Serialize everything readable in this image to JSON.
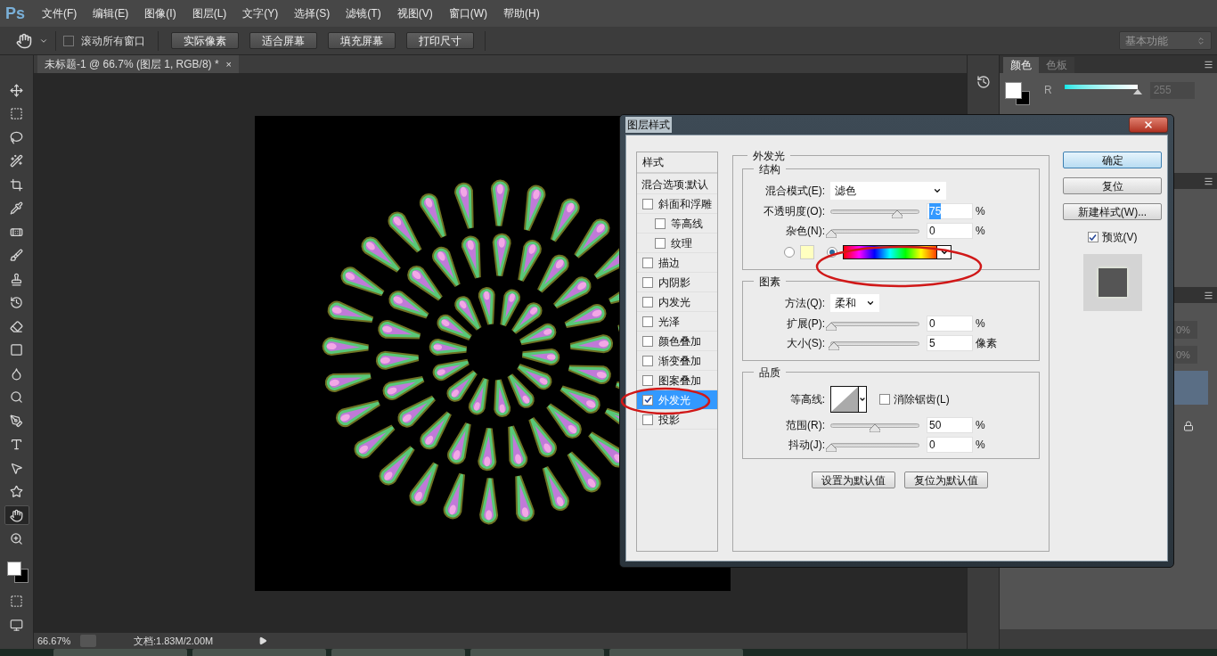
{
  "app": {
    "logo": "Ps"
  },
  "menu": [
    "文件(F)",
    "编辑(E)",
    "图像(I)",
    "图层(L)",
    "文字(Y)",
    "选择(S)",
    "滤镜(T)",
    "视图(V)",
    "窗口(W)",
    "帮助(H)"
  ],
  "options_bar": {
    "scroll_all": {
      "label": "滚动所有窗口",
      "checked": false
    },
    "buttons": [
      "实际像素",
      "适合屏幕",
      "填充屏幕",
      "打印尺寸"
    ],
    "workspace": "基本功能"
  },
  "document_tab": {
    "title": "未标题-1 @ 66.7% (图层 1, RGB/8) *",
    "close": "×"
  },
  "tools": [
    {
      "kind": "move",
      "selected": false
    },
    {
      "kind": "marquee",
      "selected": false
    },
    {
      "kind": "lasso",
      "selected": false
    },
    {
      "kind": "wand",
      "selected": false
    },
    {
      "kind": "crop",
      "selected": false
    },
    {
      "kind": "eyedropper",
      "selected": false
    },
    {
      "kind": "healing",
      "selected": false
    },
    {
      "kind": "brush",
      "selected": false
    },
    {
      "kind": "stamp",
      "selected": false
    },
    {
      "kind": "history",
      "selected": false
    },
    {
      "kind": "eraser",
      "selected": false
    },
    {
      "kind": "gradient",
      "selected": false
    },
    {
      "kind": "blur",
      "selected": false
    },
    {
      "kind": "dodge",
      "selected": false
    },
    {
      "kind": "pen",
      "selected": false
    },
    {
      "kind": "type",
      "selected": false
    },
    {
      "kind": "select",
      "selected": false
    },
    {
      "kind": "shape",
      "selected": false
    },
    {
      "kind": "hand",
      "selected": true
    },
    {
      "kind": "zoom",
      "selected": false
    }
  ],
  "color_panel": {
    "tabs": [
      {
        "label": "颜色",
        "selected": true
      },
      {
        "label": "色板",
        "selected": false
      }
    ],
    "channel": "R",
    "level": 1,
    "value": "255"
  },
  "layers_panel": {
    "fields": [
      "0%",
      "0%"
    ]
  },
  "status_bar": {
    "zoom": "66.67%",
    "document": "文档:1.83M/2.00M"
  },
  "dialog": {
    "title": "图层样式",
    "styles_header": "样式",
    "blend_options": "混合选项:默认",
    "styles": [
      {
        "label": "斜面和浮雕",
        "checked": false,
        "selected": false,
        "children": [
          {
            "label": "等高线",
            "checked": false,
            "selected": false
          },
          {
            "label": "纹理",
            "checked": false,
            "selected": false
          }
        ]
      },
      {
        "label": "描边",
        "checked": false,
        "selected": false
      },
      {
        "label": "内阴影",
        "checked": false,
        "selected": false
      },
      {
        "label": "内发光",
        "checked": false,
        "selected": false
      },
      {
        "label": "光泽",
        "checked": false,
        "selected": false
      },
      {
        "label": "颜色叠加",
        "checked": false,
        "selected": false
      },
      {
        "label": "渐变叠加",
        "checked": false,
        "selected": false
      },
      {
        "label": "图案叠加",
        "checked": false,
        "selected": false
      },
      {
        "label": "外发光",
        "checked": true,
        "selected": true
      },
      {
        "label": "投影",
        "checked": false,
        "selected": false
      }
    ],
    "section": "外发光",
    "structure": {
      "title": "结构",
      "blend_mode": {
        "label": "混合模式(E):",
        "value": "滤色"
      },
      "opacity": {
        "label": "不透明度(O):",
        "level": 0.75,
        "value": "75",
        "unit": "%",
        "text_selected": true
      },
      "noise": {
        "label": "杂色(N):",
        "level": 0,
        "value": "0",
        "unit": "%",
        "text_selected": false
      },
      "fill_options": [
        {
          "kind": "solid",
          "selected": false
        },
        {
          "kind": "gradient",
          "selected": true
        }
      ]
    },
    "elements": {
      "title": "图素",
      "technique": {
        "label": "方法(Q):",
        "value": "柔和"
      },
      "spread": {
        "label": "扩展(P):",
        "level": 0,
        "value": "0",
        "unit": "%",
        "text_selected": false
      },
      "size": {
        "label": "大小(S):",
        "level": 0.03,
        "value": "5",
        "unit": "像素",
        "text_selected": false
      }
    },
    "quality": {
      "title": "品质",
      "contour_label": "等高线:",
      "anti_alias": {
        "label": "消除锯齿(L)",
        "checked": false
      },
      "range": {
        "label": "范围(R):",
        "level": 0.5,
        "value": "50",
        "unit": "%",
        "text_selected": false
      },
      "jitter": {
        "label": "抖动(J):",
        "level": 0,
        "value": "0",
        "unit": "%",
        "text_selected": false
      }
    },
    "defaults_buttons": [
      "设置为默认值",
      "复位为默认值"
    ],
    "side_buttons": [
      {
        "label": "确定",
        "kind": "primary"
      },
      {
        "label": "复位",
        "kind": "normal"
      },
      {
        "label": "新建样式(W)...",
        "kind": "normal"
      }
    ],
    "preview": {
      "label": "预览(V)",
      "checked": true
    }
  }
}
